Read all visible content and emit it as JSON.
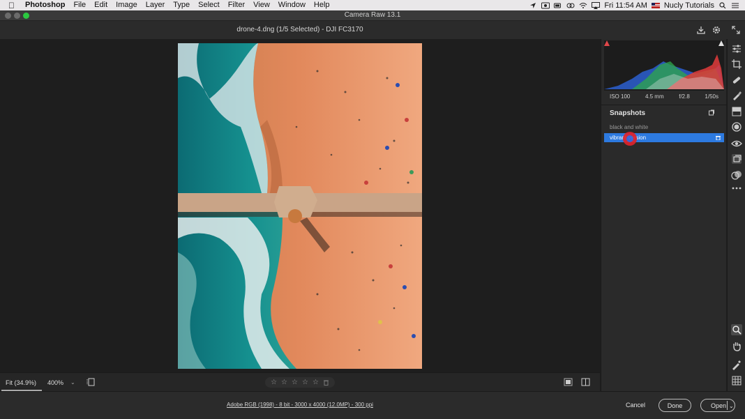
{
  "menubar": {
    "app_name": "Photoshop",
    "items": [
      "File",
      "Edit",
      "Image",
      "Layer",
      "Type",
      "Select",
      "Filter",
      "View",
      "Window",
      "Help"
    ],
    "clock": "Fri 11:54 AM",
    "user": "Nucly Tutorials"
  },
  "window": {
    "title": "Camera Raw 13.1"
  },
  "header": {
    "file_title": "drone-4.dng (1/5 Selected)  -  DJI FC3170"
  },
  "exif": {
    "iso": "ISO 100",
    "focal": "4.5 mm",
    "aperture": "f/2.8",
    "shutter": "1/50s"
  },
  "snapshots": {
    "title": "Snapshots",
    "items": [
      {
        "label": "black and white",
        "selected": false
      },
      {
        "label": "vibrant version",
        "selected": true
      }
    ]
  },
  "bottom_bar": {
    "zoom_fit": "Fit (34.9%)",
    "zoom_level": "400%"
  },
  "footer": {
    "workflow": "Adobe RGB (1998) - 8 bit - 3000 x 4000 (12.0MP) - 300 ppi",
    "cancel": "Cancel",
    "done": "Done",
    "open": "Open"
  },
  "colors": {
    "accent": "#2d7ae0",
    "panel": "#2a2a2a",
    "background": "#1e1e1e"
  }
}
